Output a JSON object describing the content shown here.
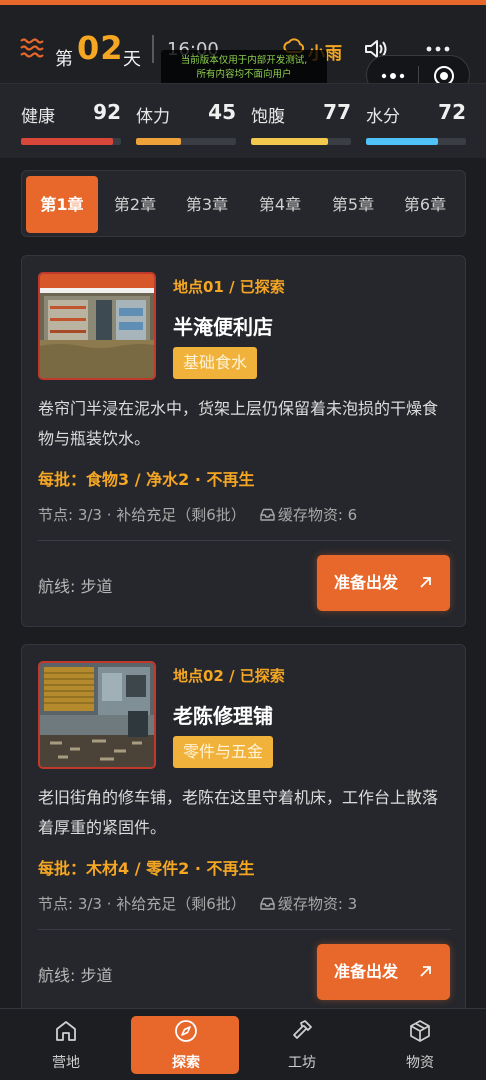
{
  "header": {
    "day_prefix": "第",
    "day_number": "02",
    "day_suffix": "天",
    "time": "16:00",
    "weather": "小雨",
    "dev_notice_line1": "当前版本仅用于内部开发测试,",
    "dev_notice_line2": "所有内容均不面向用户"
  },
  "stats": [
    {
      "label": "健康",
      "value": 92,
      "color": "#d9463a"
    },
    {
      "label": "体力",
      "value": 45,
      "color": "#f0a23a"
    },
    {
      "label": "饱腹",
      "value": 77,
      "color": "#f2c94c"
    },
    {
      "label": "水分",
      "value": 72,
      "color": "#4fc3f7"
    }
  ],
  "chapters": [
    "第1章",
    "第2章",
    "第3章",
    "第4章",
    "第5章",
    "第6章"
  ],
  "active_chapter": 0,
  "locations": [
    {
      "code_line": "地点01 / 已探索",
      "name": "半淹便利店",
      "tag": "基础食水",
      "description": "卷帘门半浸在泥水中，货架上层仍保留着未泡损的干燥食物与瓶装饮水。",
      "yield": "每批：食物3 / 净水2 · 不再生",
      "nodes": "节点: 3/3 · 补给充足（剩6批）",
      "cache": "缓存物资: 6",
      "route": "航线: 步道",
      "button": "准备出发"
    },
    {
      "code_line": "地点02 / 已探索",
      "name": "老陈修理铺",
      "tag": "零件与五金",
      "description": "老旧街角的修车铺，老陈在这里守着机床，工作台上散落着厚重的紧固件。",
      "yield": "每批：木材4 / 零件2 · 不再生",
      "nodes": "节点: 3/3 · 补给充足（剩6批）",
      "cache": "缓存物资: 3",
      "route": "航线: 步道",
      "button": "准备出发"
    }
  ],
  "nav": [
    {
      "label": "营地",
      "icon": "home-icon"
    },
    {
      "label": "探索",
      "icon": "compass-icon"
    },
    {
      "label": "工坊",
      "icon": "hammer-icon"
    },
    {
      "label": "物资",
      "icon": "package-icon"
    }
  ],
  "active_nav": 1,
  "colors": {
    "accent": "#e8672a",
    "highlight": "#f5a623",
    "tag": "#f0b23a"
  }
}
